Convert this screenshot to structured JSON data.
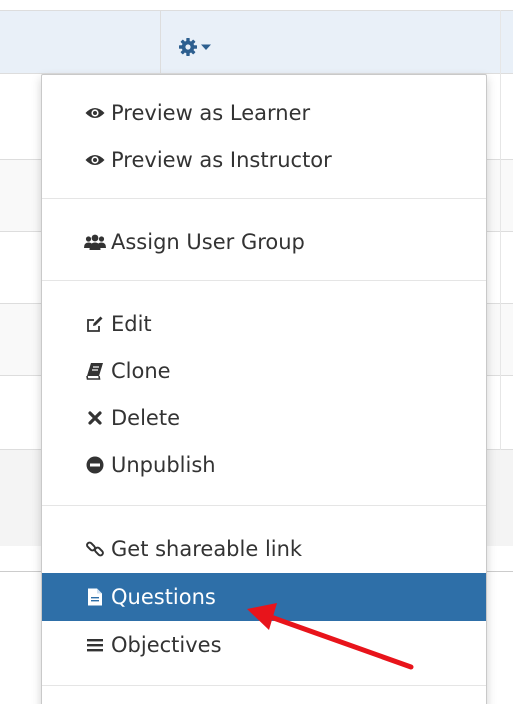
{
  "menu": {
    "items": [
      {
        "label": "Preview as Learner",
        "icon": "eye-icon"
      },
      {
        "label": "Preview as Instructor",
        "icon": "eye-icon"
      },
      {
        "label": "Assign User Group",
        "icon": "users-icon"
      },
      {
        "label": "Edit",
        "icon": "edit-icon"
      },
      {
        "label": "Clone",
        "icon": "book-icon"
      },
      {
        "label": "Delete",
        "icon": "close-icon"
      },
      {
        "label": "Unpublish",
        "icon": "minus-circle-icon"
      },
      {
        "label": "Get shareable link",
        "icon": "link-icon"
      },
      {
        "label": "Questions",
        "icon": "file-icon",
        "active": true
      },
      {
        "label": "Objectives",
        "icon": "list-icon"
      }
    ]
  },
  "toggle": {
    "icon": "gear-icon",
    "caret": "caret-down-icon"
  },
  "colors": {
    "active_bg": "#2e6fa8",
    "active_text": "#ffffff",
    "header_bg": "#e9f0f8",
    "arrow": "#e8141b"
  }
}
